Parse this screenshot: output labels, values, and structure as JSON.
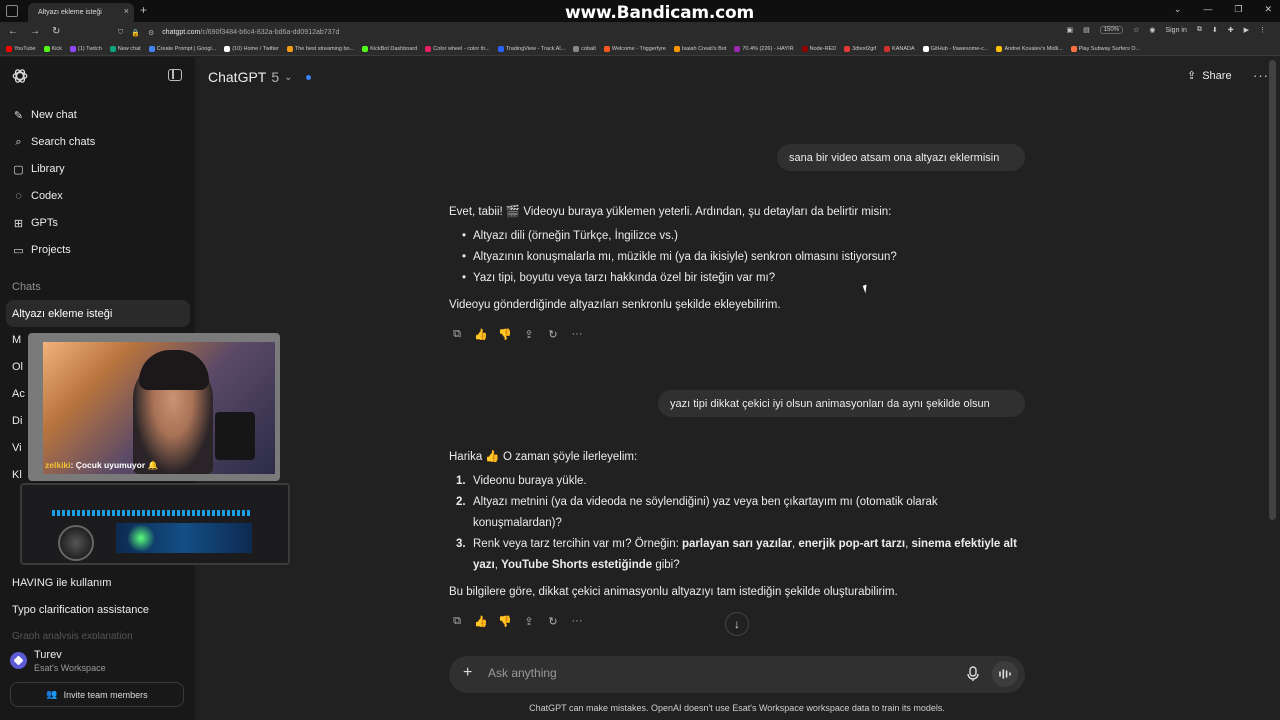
{
  "browser": {
    "tab_title": "Altyazı ekleme isteği",
    "tab_close": "×",
    "new_tab": "+",
    "url_host": "chatgpt.com",
    "url_path": "/c/690f3484-b6c4-832a-bd6a-dd0912ab737d",
    "zoom": "150%",
    "sign_in": "Sign in",
    "watermark": "www.Bandicam.com",
    "bookmarks": [
      {
        "label": "YouTube",
        "color": "#ff0000"
      },
      {
        "label": "Kick",
        "color": "#53fc18"
      },
      {
        "label": "(1) Twitch",
        "color": "#9146ff"
      },
      {
        "label": "New chat",
        "color": "#10a37f"
      },
      {
        "label": "Create Prompt | Googl...",
        "color": "#4285f4"
      },
      {
        "label": "(10) Home / Twitter",
        "color": "#ffffff"
      },
      {
        "label": "The best streaming bo...",
        "color": "#f39c12"
      },
      {
        "label": "KickBot Dashboard",
        "color": "#53fc18"
      },
      {
        "label": "Color wheel - color th...",
        "color": "#e91e63"
      },
      {
        "label": "TradingView - Track Al...",
        "color": "#2962ff"
      },
      {
        "label": "cobalt",
        "color": "#888888"
      },
      {
        "label": "Welcome - Triggerfyre",
        "color": "#ff5722"
      },
      {
        "label": "Isaiah Creati's Bot",
        "color": "#ff9800"
      },
      {
        "label": "70.4% (226) - HAYIR",
        "color": "#9c27b0"
      },
      {
        "label": "Node-RED",
        "color": "#8f0000"
      },
      {
        "label": "3dtext2gif",
        "color": "#e53935"
      },
      {
        "label": "KANADA",
        "color": "#d32f2f"
      },
      {
        "label": "GitHub - f/awesome-c...",
        "color": "#ffffff"
      },
      {
        "label": "Andrei Kovalev's Midli...",
        "color": "#ffc107"
      },
      {
        "label": "Play Subway Surfers O...",
        "color": "#ff7043"
      }
    ]
  },
  "sidebar": {
    "nav": [
      {
        "label": "New chat",
        "icon": "edit-icon"
      },
      {
        "label": "Search chats",
        "icon": "search-icon"
      },
      {
        "label": "Library",
        "icon": "library-icon"
      },
      {
        "label": "Codex",
        "icon": "codex-icon"
      },
      {
        "label": "GPTs",
        "icon": "gpts-icon"
      },
      {
        "label": "Projects",
        "icon": "folder-icon"
      }
    ],
    "chats_heading": "Chats",
    "active_chat": "Altyazı ekleme isteği",
    "partial_chats": [
      "M",
      "Ol",
      "Ac",
      "Di",
      "Vi",
      "Kl"
    ],
    "chats_bottom": [
      "HAVING ile kullanım",
      "Typo clarification assistance",
      "Graph analysis explanation"
    ],
    "user_name": "Turev",
    "user_workspace": "Esat's Workspace",
    "invite": "Invite team members"
  },
  "webcam": {
    "caption_user": "zelkiki",
    "caption_text": ": Çocuk uyumuyor 🔔"
  },
  "header": {
    "model": "ChatGPT",
    "model_version": "5",
    "share": "Share"
  },
  "conversation": {
    "user_1": "sana bir video atsam ona altyazı eklermisin",
    "assistant_1_intro": "Evet, tabii! 🎬 Videoyu buraya yüklemen yeterli. Ardından, şu detayları da belirtir misin:",
    "assistant_1_bullets": [
      "Altyazı dili (örneğin Türkçe, İngilizce vs.)",
      "Altyazının konuşmalarla mı, müzikle mi (ya da ikisiyle) senkron olmasını istiyorsun?",
      "Yazı tipi, boyutu veya tarzı hakkında özel bir isteğin var mı?"
    ],
    "assistant_1_outro": "Videoyu gönderdiğinde altyazıları senkronlu şekilde ekleyebilirim.",
    "user_2": "yazı tipi dikkat çekici iyi olsun animasyonları da aynı şekilde olsun",
    "assistant_2_intro": "Harika 👍 O zaman şöyle ilerleyelim:",
    "assistant_2_steps": [
      {
        "n": "1.",
        "text": "Videonu buraya yükle."
      },
      {
        "n": "2.",
        "text": "Altyazı metnini (ya da videoda ne söylendiğini) yaz veya ben çıkartayım mı (otomatik olarak konuşmalardan)?"
      },
      {
        "n": "3.",
        "pre": "Renk veya tarz tercihin var mı? Örneğin: ",
        "b1": "parlayan sarı yazılar",
        "c1": ", ",
        "b2": "enerjik pop-art tarzı",
        "c2": ", ",
        "b3": "sinema efektiyle alt yazı",
        "c3": ", ",
        "b4": "YouTube Shorts estetiğinde",
        "post": " gibi?"
      }
    ],
    "assistant_2_outro": "Bu bilgilere göre, dikkat çekici animasyonlu altyazıyı tam istediğin şekilde oluşturabilirim."
  },
  "composer": {
    "placeholder": "Ask anything",
    "disclaimer": "ChatGPT can make mistakes. OpenAI doesn't use Esat's Workspace workspace data to train its models."
  }
}
